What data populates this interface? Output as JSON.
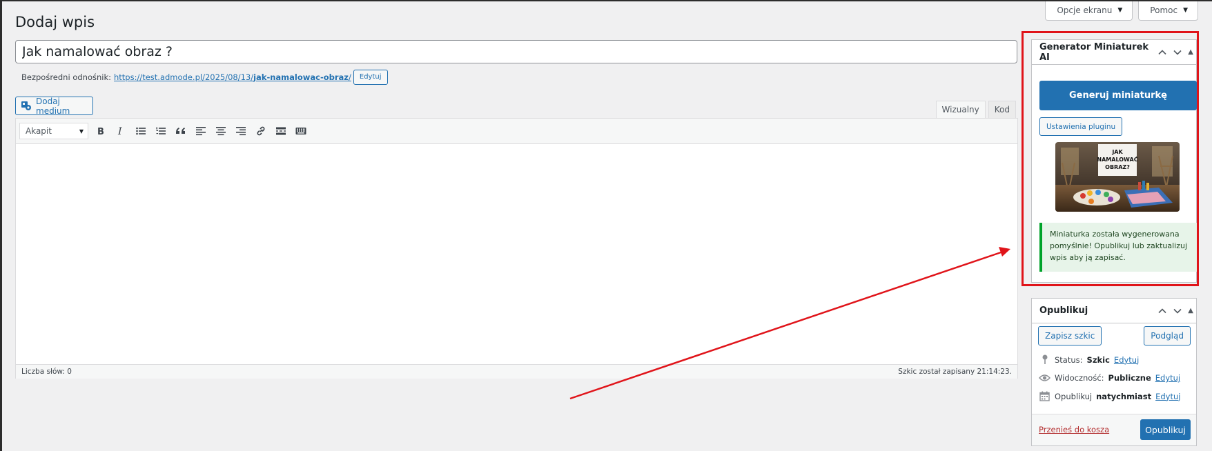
{
  "screen_options": {
    "options_label": "Opcje ekranu",
    "help_label": "Pomoc"
  },
  "page": {
    "title": "Dodaj wpis"
  },
  "post": {
    "title_value": "Jak namalować obraz ?",
    "permalink_label": "Bezpośredni odnośnik:",
    "permalink_base": "https://test.admode.pl/2025/08/13/",
    "permalink_slug": "jak-namalowac-obraz",
    "permalink_end": "/",
    "edit_label": "Edytuj"
  },
  "media": {
    "add_media_label": "Dodaj medium"
  },
  "editor": {
    "tabs": [
      {
        "label": "Wizualny",
        "active": true
      },
      {
        "label": "Kod",
        "active": false
      }
    ],
    "format_value": "Akapit",
    "toolbar_icons": [
      "bold-icon",
      "italic-icon",
      "bullet-list-icon",
      "numbered-list-icon",
      "blockquote-icon",
      "align-left-icon",
      "align-center-icon",
      "align-right-icon",
      "link-icon",
      "read-more-icon",
      "toolbar-toggle-icon"
    ],
    "word_count": "Liczba słów: 0",
    "autosave": "Szkic został zapisany 21:14:23."
  },
  "generator": {
    "title": "Generator Miniaturek AI",
    "generate_label": "Generuj miniaturkę",
    "settings_label": "Ustawienia pluginu",
    "thumbnail_text": [
      "JAK",
      "NAMALOWAĆ",
      "OBRAZ?"
    ],
    "notice": "Miniaturka została wygenerowana pomyślnie! Opublikuj lub zaktualizuj wpis aby ją zapisać.",
    "notice_color": "#00a32a"
  },
  "publish": {
    "title": "Opublikuj",
    "save_draft_label": "Zapisz szkic",
    "preview_label": "Podgląd",
    "status_label": "Status:",
    "status_value": "Szkic",
    "visibility_label": "Widoczność:",
    "visibility_value": "Publiczne",
    "schedule_label": "Opublikuj",
    "schedule_value": "natychmiast",
    "edit_label": "Edytuj",
    "trash_label": "Przenieś do kosza",
    "publish_label": "Opublikuj"
  },
  "colors": {
    "accent": "#2271b1",
    "annotation": "#e0141a",
    "trash": "#b32d2e"
  }
}
